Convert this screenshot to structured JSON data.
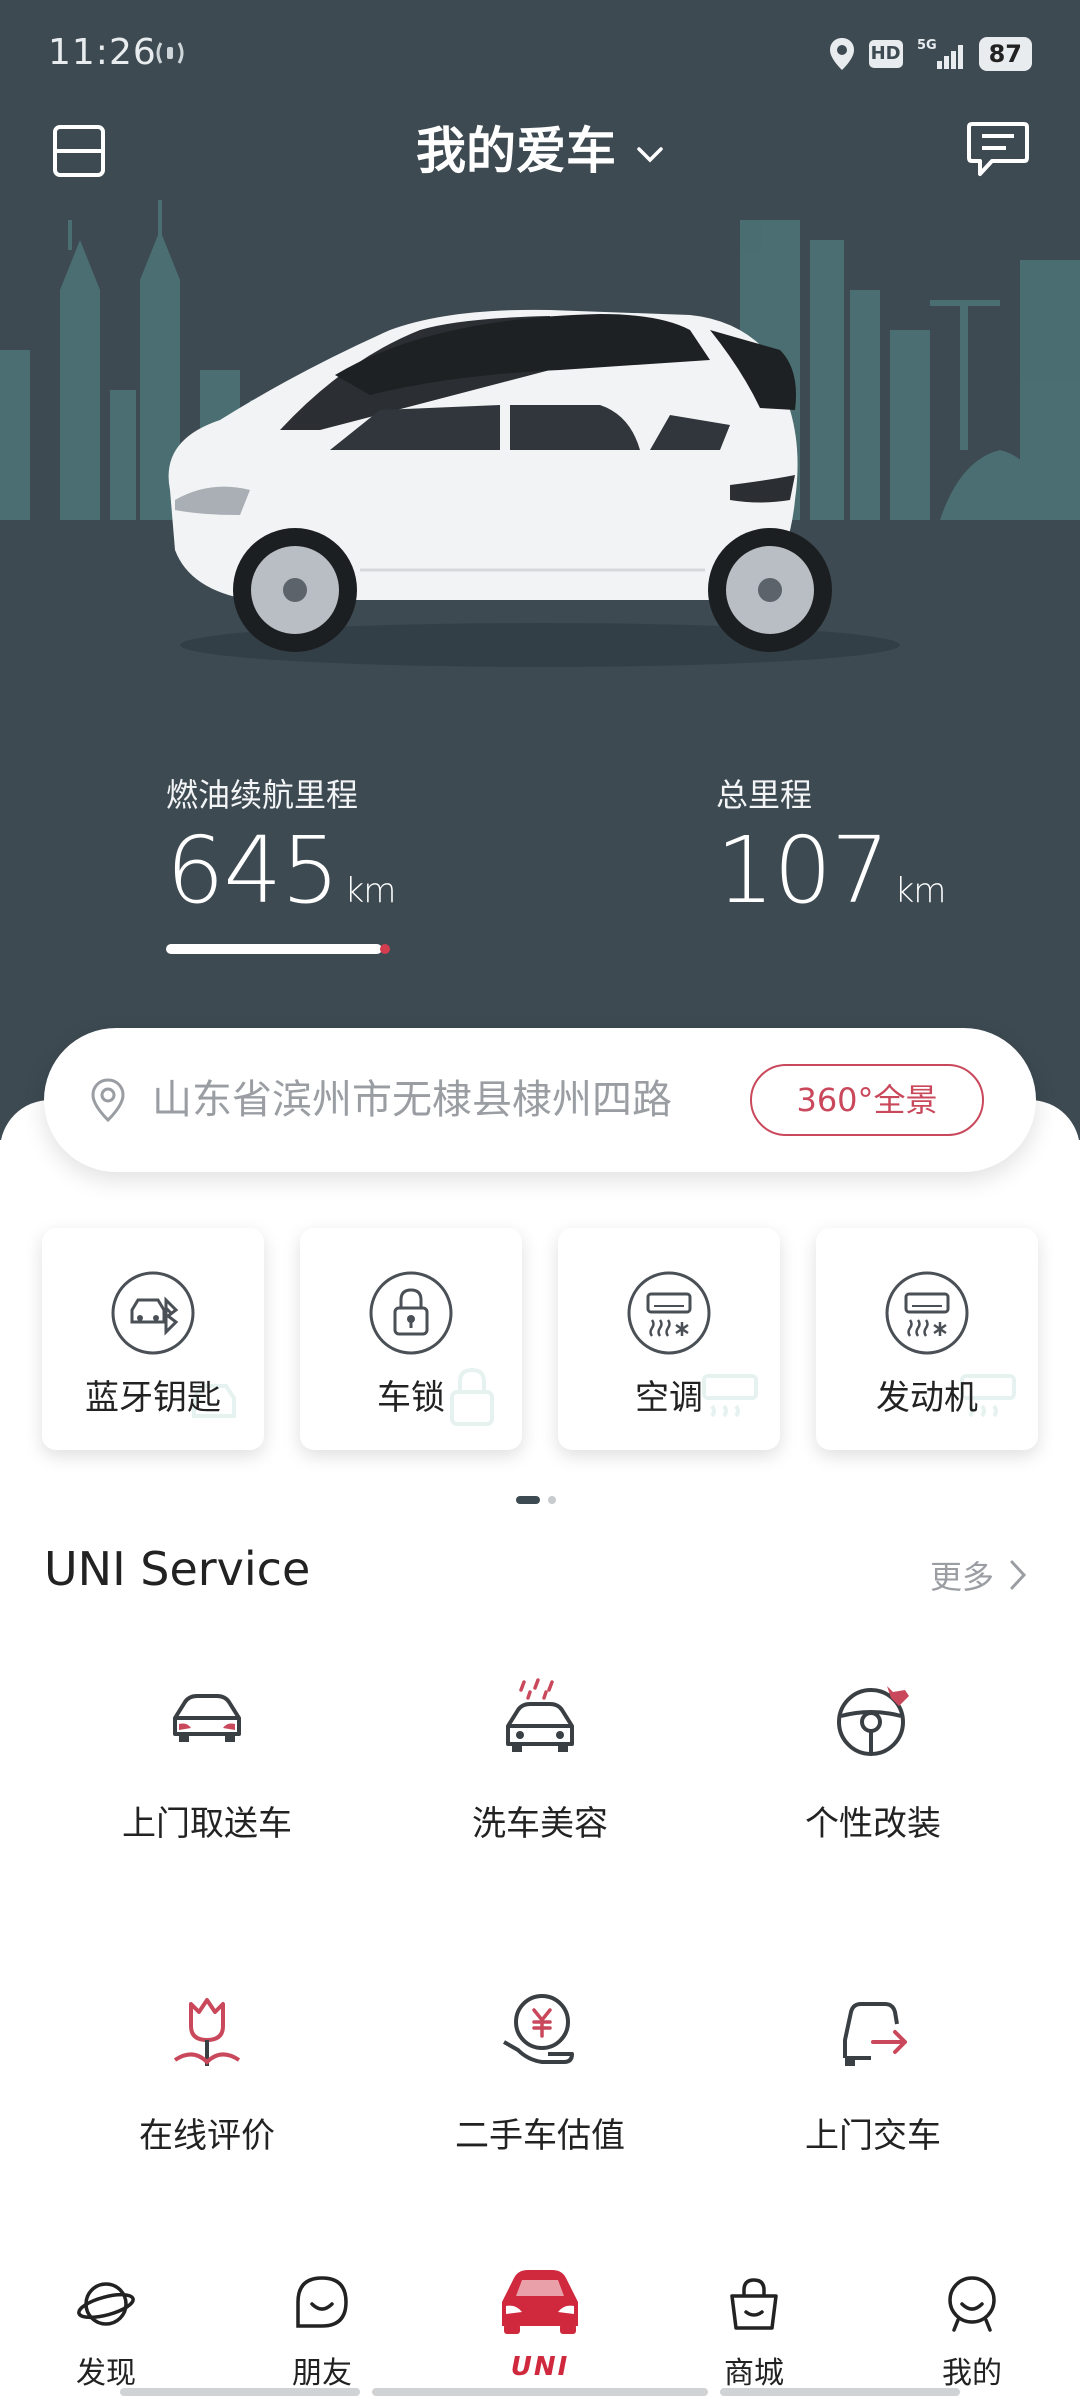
{
  "status_bar": {
    "time": "11:26",
    "hd": "HD",
    "network": "5G",
    "battery": "87"
  },
  "header": {
    "title": "我的爱车"
  },
  "stats": {
    "fuel_range": {
      "label": "燃油续航里程",
      "value": "645",
      "unit": "km",
      "level": 0.9
    },
    "total_mileage": {
      "label": "总里程",
      "value": "107",
      "unit": "km"
    }
  },
  "location": {
    "address": "山东省滨州市无棣县棣州四路",
    "panorama_label": "360°全景"
  },
  "controls": [
    {
      "label": "蓝牙钥匙",
      "icon": "bluetooth-key-icon"
    },
    {
      "label": "车锁",
      "icon": "lock-icon"
    },
    {
      "label": "空调",
      "icon": "air-conditioner-icon"
    },
    {
      "label": "发动机",
      "icon": "engine-icon"
    }
  ],
  "service": {
    "title": "UNI Service",
    "more_label": "更多",
    "items": [
      {
        "label": "上门取送车",
        "icon": "car-pickup-icon"
      },
      {
        "label": "洗车美容",
        "icon": "car-wash-icon"
      },
      {
        "label": "个性改装",
        "icon": "steering-wheel-icon"
      },
      {
        "label": "在线评价",
        "icon": "tulip-icon"
      },
      {
        "label": "二手车估值",
        "icon": "yuan-hand-icon"
      },
      {
        "label": "上门交车",
        "icon": "car-delivery-icon"
      }
    ]
  },
  "bottom_nav": [
    {
      "label": "发现",
      "icon": "planet-icon"
    },
    {
      "label": "朋友",
      "icon": "chat-smile-icon"
    },
    {
      "label": "UNI",
      "icon": "car-front-icon",
      "active": true
    },
    {
      "label": "商城",
      "icon": "shopping-bag-icon"
    },
    {
      "label": "我的",
      "icon": "profile-face-icon"
    }
  ],
  "colors": {
    "hero_bg": "#3d4a52",
    "accent": "#c9485b",
    "active_tab": "#d0293e",
    "icon_stroke": "#3a3f44"
  }
}
